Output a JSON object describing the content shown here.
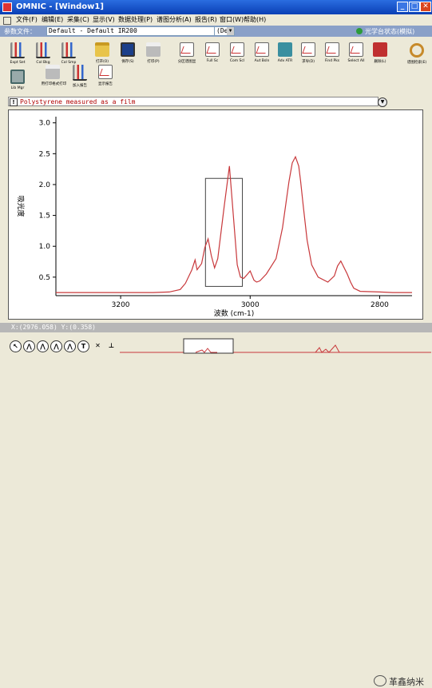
{
  "window": {
    "title": "OMNIC - [Window1]",
    "minimize": "_",
    "maximize": "□",
    "close": "✕"
  },
  "menu": {
    "items": [
      "文件(F)",
      "编辑(E)",
      "采集(C)",
      "显示(V)",
      "数据处理(P)",
      "谱图分析(A)",
      "报告(R)",
      "窗口(W)",
      "帮助(H)"
    ]
  },
  "params": {
    "label": "参数文件：",
    "value": "Default - Default IR200",
    "suffix": "(De",
    "status": "光学台状态(模拟)"
  },
  "toolbar": {
    "row1": [
      {
        "label": "Expt Set",
        "icon": "bars-icon"
      },
      {
        "label": "Col Bkg",
        "icon": "bars-icon"
      },
      {
        "label": "Col Smp",
        "icon": "bars-icon"
      },
      {
        "label": "打开(O)",
        "icon": "folder-icon"
      },
      {
        "label": "保存(S)",
        "icon": "disk-icon"
      },
      {
        "label": "打印(P)",
        "icon": "printer-icon"
      },
      {
        "label": "分区谱图显",
        "icon": "chart-icon"
      },
      {
        "label": "Full Sc",
        "icon": "chart-icon"
      },
      {
        "label": "Com Scl",
        "icon": "chart-icon"
      },
      {
        "label": "Aut Bsln",
        "icon": "chart-icon"
      },
      {
        "label": "Adv ATR",
        "icon": "teal-icon"
      },
      {
        "label": "求导(D)",
        "icon": "chart-icon"
      },
      {
        "label": "Find Pks",
        "icon": "chart-icon"
      },
      {
        "label": "Select All",
        "icon": "chart-icon"
      },
      {
        "label": "删除(L)",
        "icon": "red-icon"
      },
      {
        "label": "谱图检索(E)",
        "icon": "search-icon"
      }
    ],
    "row2": [
      {
        "label": "Lib Mgr",
        "icon": "library-icon"
      },
      {
        "label": "用打印格式打印",
        "icon": "printer-icon"
      },
      {
        "label": "加入报告",
        "icon": "bars-icon"
      },
      {
        "label": "显示报告",
        "icon": "chart-icon"
      }
    ]
  },
  "spectrum": {
    "title": "Polystyrene measured as a film",
    "flag": "!",
    "dropdown": "▼"
  },
  "coordinates": "X:(2976.058) Y:(0.358)",
  "watermark": "革鑫纳米",
  "chart_data": {
    "type": "line",
    "xlabel": "波数 (cm-1)",
    "ylabel": "吸光度",
    "xlim": [
      3300,
      2750
    ],
    "ylim": [
      0.2,
      3.1
    ],
    "xticks": [
      3200,
      3000,
      2800
    ],
    "yticks": [
      0.5,
      1.0,
      1.5,
      2.0,
      2.5,
      3.0
    ],
    "grid": false,
    "series": [
      {
        "color": "#C8383B",
        "x": [
          3300,
          3250,
          3200,
          3150,
          3125,
          3108,
          3100,
          3090,
          3085,
          3082,
          3075,
          3070,
          3065,
          3060,
          3055,
          3050,
          3040,
          3032,
          3026,
          3020,
          3015,
          3010,
          3004,
          3000,
          2994,
          2990,
          2985,
          2975,
          2960,
          2950,
          2940,
          2935,
          2930,
          2925,
          2922,
          2918,
          2912,
          2905,
          2895,
          2880,
          2870,
          2865,
          2860,
          2850,
          2845,
          2840,
          2830,
          2800,
          2780,
          2750
        ],
        "y": [
          0.25,
          0.25,
          0.25,
          0.25,
          0.26,
          0.3,
          0.4,
          0.62,
          0.78,
          0.62,
          0.72,
          0.98,
          1.12,
          0.85,
          0.65,
          0.8,
          1.65,
          2.3,
          1.5,
          0.7,
          0.5,
          0.48,
          0.55,
          0.6,
          0.45,
          0.42,
          0.44,
          0.55,
          0.8,
          1.3,
          2.05,
          2.35,
          2.45,
          2.3,
          2.05,
          1.65,
          1.1,
          0.7,
          0.5,
          0.42,
          0.52,
          0.68,
          0.76,
          0.55,
          0.42,
          0.32,
          0.27,
          0.26,
          0.25,
          0.25
        ]
      }
    ],
    "selection_box": {
      "x": [
        3069,
        3012
      ],
      "y": [
        0.35,
        2.1
      ]
    }
  }
}
